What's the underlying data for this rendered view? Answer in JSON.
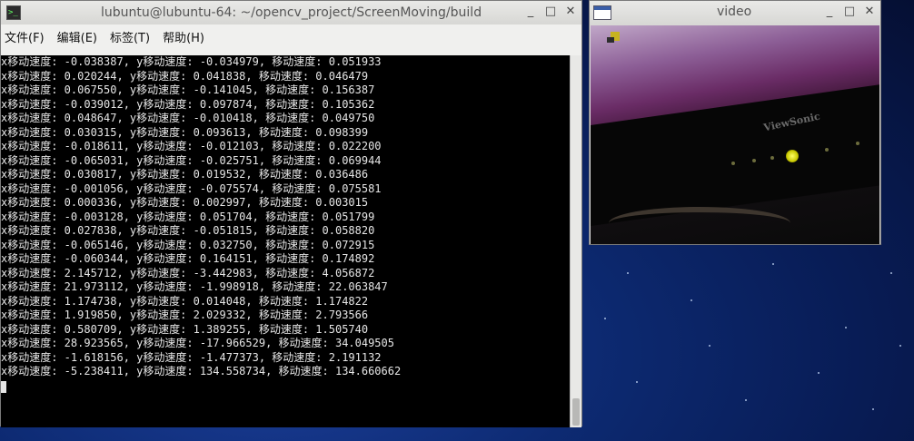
{
  "terminal": {
    "title": "lubuntu@lubuntu-64: ~/opencv_project/ScreenMoving/build",
    "icon": "terminal-icon",
    "window_buttons": [
      "_",
      "□",
      "✕"
    ],
    "menu": [
      "文件(F)",
      "编辑(E)",
      "标签(T)",
      "帮助(H)"
    ],
    "lines": [
      "x移动速度: -0.038387, y移动速度: -0.034979, 移动速度: 0.051933",
      "x移动速度: 0.020244, y移动速度: 0.041838, 移动速度: 0.046479",
      "x移动速度: 0.067550, y移动速度: -0.141045, 移动速度: 0.156387",
      "x移动速度: -0.039012, y移动速度: 0.097874, 移动速度: 0.105362",
      "x移动速度: 0.048647, y移动速度: -0.010418, 移动速度: 0.049750",
      "x移动速度: 0.030315, y移动速度: 0.093613, 移动速度: 0.098399",
      "x移动速度: -0.018611, y移动速度: -0.012103, 移动速度: 0.022200",
      "x移动速度: -0.065031, y移动速度: -0.025751, 移动速度: 0.069944",
      "x移动速度: 0.030817, y移动速度: 0.019532, 移动速度: 0.036486",
      "x移动速度: -0.001056, y移动速度: -0.075574, 移动速度: 0.075581",
      "x移动速度: 0.000336, y移动速度: 0.002997, 移动速度: 0.003015",
      "x移动速度: -0.003128, y移动速度: 0.051704, 移动速度: 0.051799",
      "x移动速度: 0.027838, y移动速度: -0.051815, 移动速度: 0.058820",
      "x移动速度: -0.065146, y移动速度: 0.032750, 移动速度: 0.072915",
      "x移动速度: -0.060344, y移动速度: 0.164151, 移动速度: 0.174892",
      "x移动速度: 2.145712, y移动速度: -3.442983, 移动速度: 4.056872",
      "x移动速度: 21.973112, y移动速度: -1.998918, 移动速度: 22.063847",
      "x移动速度: 1.174738, y移动速度: 0.014048, 移动速度: 1.174822",
      "x移动速度: 1.919850, y移动速度: 2.029332, 移动速度: 2.793566",
      "x移动速度: 0.580709, y移动速度: 1.389255, 移动速度: 1.505740",
      "x移动速度: 28.923565, y移动速度: -17.966529, 移动速度: 34.049505",
      "x移动速度: -1.618156, y移动速度: -1.477373, 移动速度: 2.191132",
      "x移动速度: -5.238411, y移动速度: 134.558734, 移动速度: 134.660662"
    ]
  },
  "video": {
    "title": "video",
    "icon": "window-icon",
    "window_buttons": [
      "_",
      "□",
      "✕"
    ],
    "frame_brand": "ViewSonic"
  },
  "desktop": {
    "background_color": "#0d2a72"
  }
}
